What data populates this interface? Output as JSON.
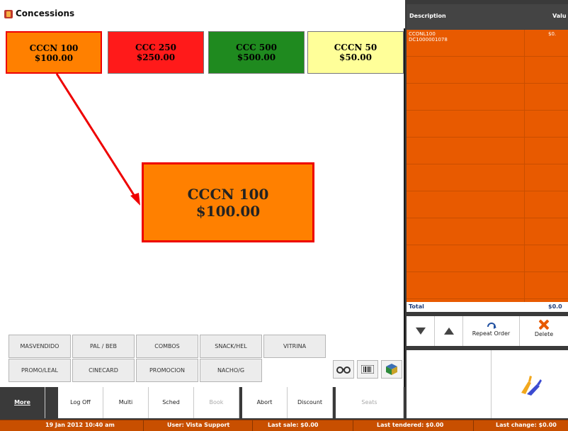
{
  "window": {
    "title": "Concessions"
  },
  "items": [
    {
      "name": "CCCN 100",
      "price": "$100.00",
      "bg": "#ff8000",
      "fg": "#111111"
    },
    {
      "name": "CCC 250",
      "price": "$250.00",
      "bg": "#ff1a1a",
      "fg": "#111111"
    },
    {
      "name": "CCC 500",
      "price": "$500.00",
      "bg": "#1f8a1f",
      "fg": "#111111"
    },
    {
      "name": "CCCN 50",
      "price": "$50.00",
      "bg": "#ffff99",
      "fg": "#111111"
    }
  ],
  "zoom": {
    "name": "CCCN 100",
    "price": "$100.00"
  },
  "categories_row1": [
    "MASVENDIDO",
    "PAL / BEB",
    "COMBOS",
    "SNACK/HEL",
    "VITRINA"
  ],
  "categories_row2": [
    "PROMO/LEAL",
    "CINECARD",
    "PROMOCION",
    "NACHO/G"
  ],
  "tool_icons": [
    "binoculars-icon",
    "barcode-icon",
    "cube-icon"
  ],
  "nav": [
    {
      "label": "More",
      "state": "active"
    },
    {
      "label": "Log Off",
      "state": "normal"
    },
    {
      "label": "Multi",
      "state": "normal"
    },
    {
      "label": "Sched",
      "state": "normal"
    },
    {
      "label": "Book",
      "state": "disabled"
    },
    {
      "label": "Abort",
      "state": "normal"
    },
    {
      "label": "Discount",
      "state": "normal"
    },
    {
      "label": "Seats",
      "state": "disabled"
    }
  ],
  "order": {
    "header_description": "Description",
    "header_value": "Valu",
    "rows": [
      {
        "desc_line1": "CCONL100",
        "desc_line2": "DC1000001078",
        "value": "$0."
      }
    ],
    "total_label": "Total",
    "total_value": "$0.0"
  },
  "actions": {
    "repeat_label": "Repeat Order",
    "delete_label": "Delete"
  },
  "status": {
    "datetime": "19 Jan 2012 10:40 am",
    "user": "User: Vista Support",
    "last_sale": "Last sale: $0.00",
    "last_tendered": "Last tendered: $0.00",
    "last_change": "Last change: $0.00"
  },
  "colors": {
    "accent": "#e85a00",
    "status": "#c84f00",
    "highlight": "#ee0000"
  }
}
